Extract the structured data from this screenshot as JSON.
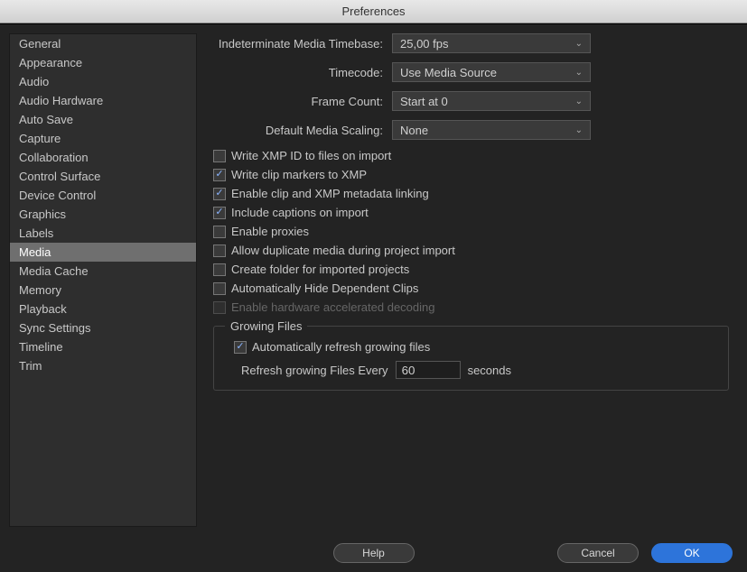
{
  "window": {
    "title": "Preferences"
  },
  "sidebar": {
    "items": [
      "General",
      "Appearance",
      "Audio",
      "Audio Hardware",
      "Auto Save",
      "Capture",
      "Collaboration",
      "Control Surface",
      "Device Control",
      "Graphics",
      "Labels",
      "Media",
      "Media Cache",
      "Memory",
      "Playback",
      "Sync Settings",
      "Timeline",
      "Trim"
    ],
    "selectedIndex": 11
  },
  "dropdowns": [
    {
      "label": "Indeterminate Media Timebase:",
      "value": "25,00 fps"
    },
    {
      "label": "Timecode:",
      "value": "Use Media Source"
    },
    {
      "label": "Frame Count:",
      "value": "Start at 0"
    },
    {
      "label": "Default Media Scaling:",
      "value": "None"
    }
  ],
  "checkboxes": [
    {
      "label": "Write XMP ID to files on import",
      "checked": false,
      "disabled": false
    },
    {
      "label": "Write clip markers to XMP",
      "checked": true,
      "disabled": false
    },
    {
      "label": "Enable clip and XMP metadata linking",
      "checked": true,
      "disabled": false
    },
    {
      "label": "Include captions on import",
      "checked": true,
      "disabled": false
    },
    {
      "label": "Enable proxies",
      "checked": false,
      "disabled": false
    },
    {
      "label": "Allow duplicate media during project import",
      "checked": false,
      "disabled": false
    },
    {
      "label": "Create folder for imported projects",
      "checked": false,
      "disabled": false
    },
    {
      "label": "Automatically Hide Dependent Clips",
      "checked": false,
      "disabled": false
    },
    {
      "label": "Enable hardware accelerated decoding",
      "checked": false,
      "disabled": true
    }
  ],
  "group": {
    "legend": "Growing Files",
    "auto": {
      "label": "Automatically refresh growing files",
      "checked": true
    },
    "interval": {
      "prefix": "Refresh growing Files Every",
      "value": "60",
      "suffix": "seconds"
    }
  },
  "buttons": {
    "help": "Help",
    "cancel": "Cancel",
    "ok": "OK"
  }
}
